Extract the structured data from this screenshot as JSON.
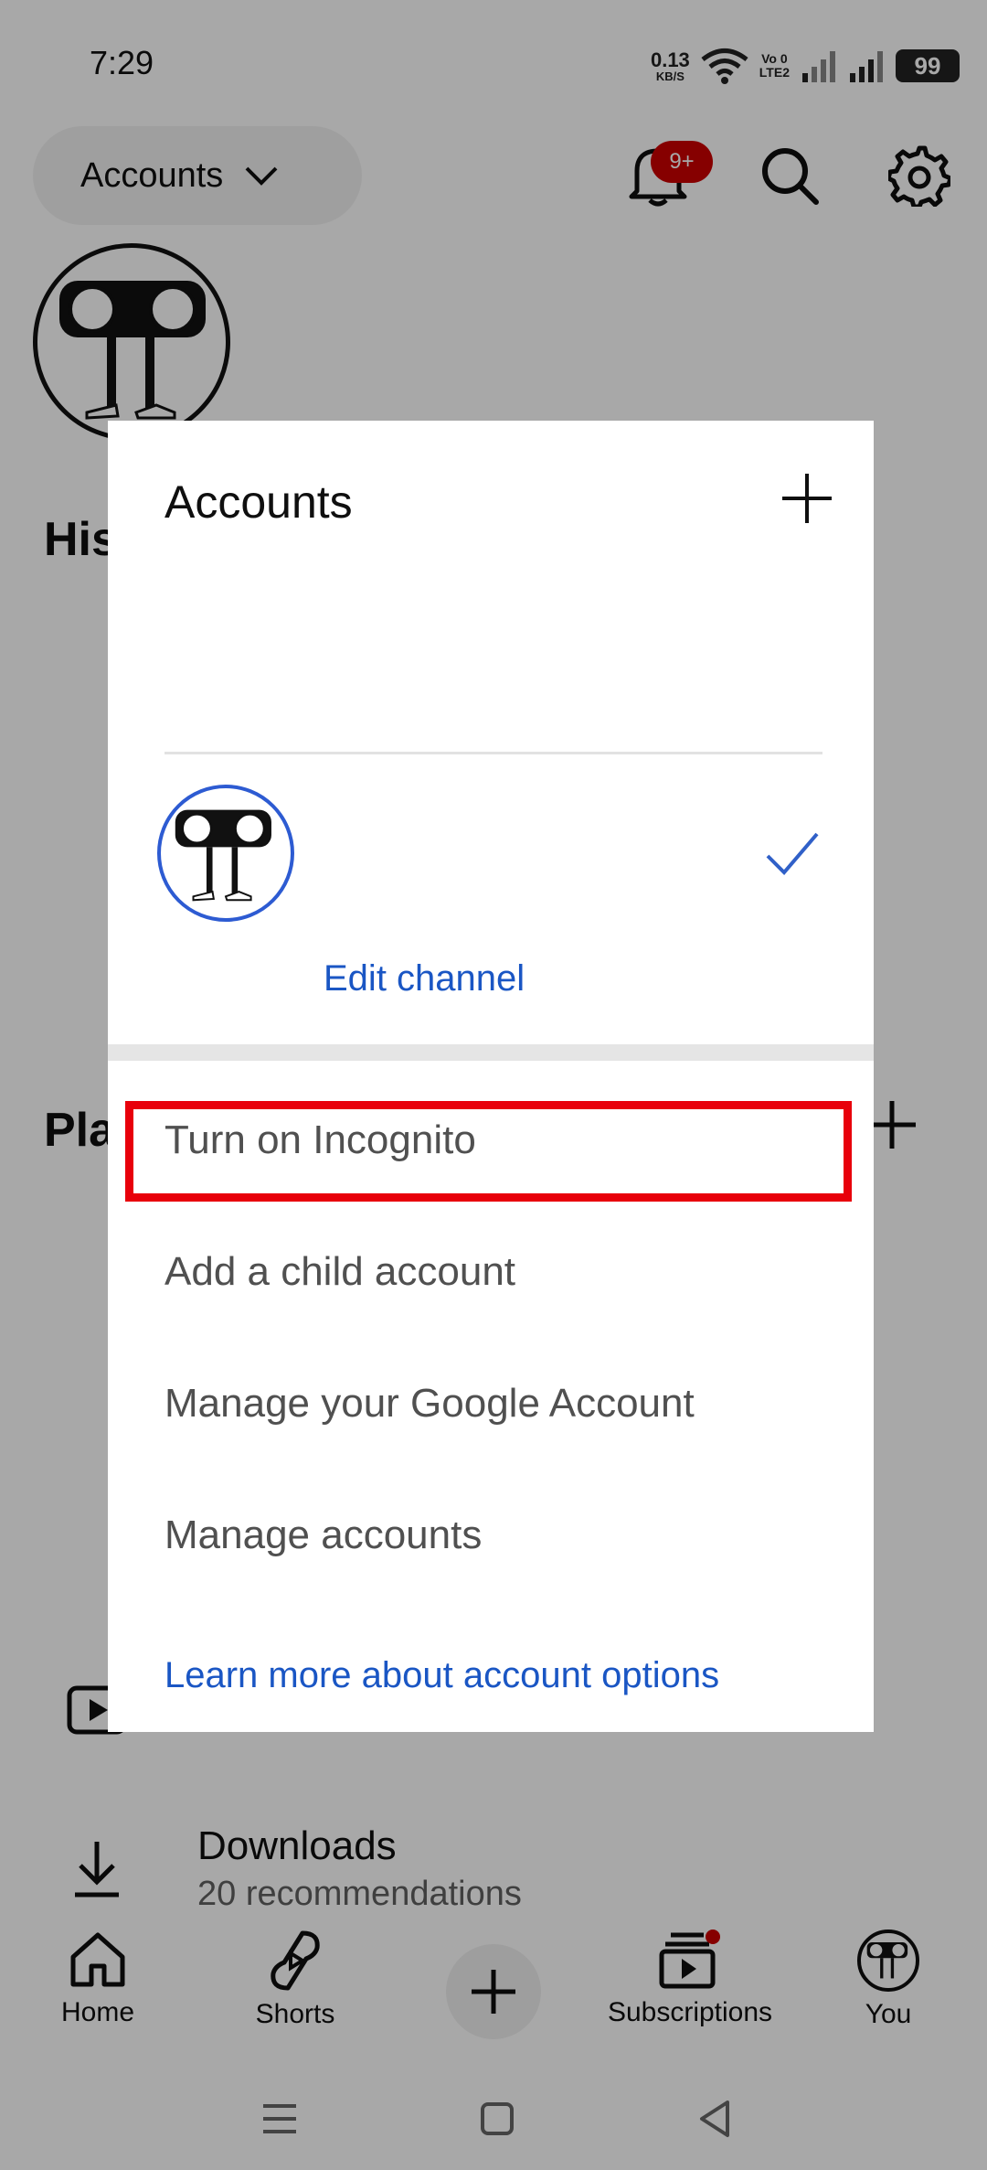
{
  "status_bar": {
    "time": "7:29",
    "net_speed_value": "0.13",
    "net_speed_unit": "KB/S",
    "volte_top": "Vo 0",
    "volte_bottom": "LTE2",
    "battery": "99"
  },
  "header": {
    "accounts_label": "Accounts",
    "notification_badge": "9+"
  },
  "background": {
    "history_partial": "His",
    "playlists_partial": "Pla",
    "downloads_title": "Downloads",
    "downloads_subtitle": "20 recommendations"
  },
  "bottom_nav": {
    "items": [
      {
        "label": "Home"
      },
      {
        "label": "Shorts"
      },
      {
        "label": "Subscriptions"
      },
      {
        "label": "You"
      }
    ]
  },
  "dialog": {
    "title": "Accounts",
    "edit_channel": "Edit channel",
    "menu": [
      {
        "label": "Turn on Incognito"
      },
      {
        "label": "Add a child account"
      },
      {
        "label": "Manage your Google Account"
      },
      {
        "label": "Manage accounts"
      }
    ],
    "learn_more": "Learn more about account options"
  },
  "colors": {
    "accent_red": "#e8000b",
    "link_blue": "#1a56c4",
    "badge_red": "#cc0000"
  }
}
